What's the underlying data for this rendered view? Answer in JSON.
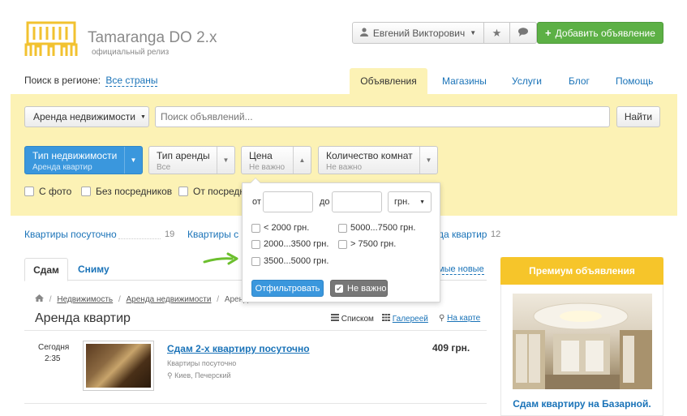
{
  "header": {
    "logo_title": "Tamaranga DO 2.x",
    "logo_subtitle": "официальный релиз",
    "user_name": "Евгений Викторович",
    "add_button": "Добавить объявление"
  },
  "region": {
    "label": "Поиск в регионе:",
    "value": "Все страны"
  },
  "nav_tabs": [
    "Объявления",
    "Магазины",
    "Услуги",
    "Блог",
    "Помощь"
  ],
  "search": {
    "category": "Аренда недвижимости",
    "placeholder": "Поиск объявлений...",
    "submit": "Найти"
  },
  "filters": {
    "property_type": {
      "label": "Тип недвижимости",
      "value": "Аренда квартир"
    },
    "rent_type": {
      "label": "Тип аренды",
      "value": "Все"
    },
    "price": {
      "label": "Цена",
      "value": "Не важно"
    },
    "rooms": {
      "label": "Количество комнат",
      "value": "Не важно"
    },
    "checkboxes": [
      "С фото",
      "Без посредников",
      "От посредн"
    ]
  },
  "price_dropdown": {
    "from_label": "от",
    "to_label": "до",
    "currency": "грн.",
    "ranges": [
      "< 2000 грн.",
      "2000...3500 грн.",
      "3500...5000 грн.",
      "5000...7500 грн.",
      "> 7500 грн."
    ],
    "apply": "Отфильтровать",
    "no_matter": "Не важно"
  },
  "categories": [
    {
      "label": "Квартиры посуточно",
      "count": "19"
    },
    {
      "label": "Квартиры с",
      "count": ""
    },
    {
      "label": "да квартир",
      "count": "12"
    }
  ],
  "list_tabs": {
    "active": "Сдам",
    "other": "Сниму",
    "sort": "мые новые"
  },
  "breadcrumbs": [
    "Недвижимость",
    "Аренда недвижимости",
    "Аренда к"
  ],
  "page_title": "Аренда квартир",
  "view_modes": {
    "list": "Списком",
    "gallery": "Галерeей",
    "map": "На карте"
  },
  "listing": {
    "date": "Сегодня",
    "time": "2:35",
    "title": "Сдам 2-х квартиру посуточно",
    "category": "Квартиры посуточно",
    "location": "Киев, Печерский",
    "price": "409 грн."
  },
  "premium": {
    "title": "Премиум объявления",
    "item_title": "Сдам квартиру на Базарной."
  },
  "colors": {
    "accent": "#3a97dd",
    "add_green": "#5cb045",
    "band": "#fcf2b5",
    "premium": "#f6c52a",
    "link": "#1a73b8"
  }
}
